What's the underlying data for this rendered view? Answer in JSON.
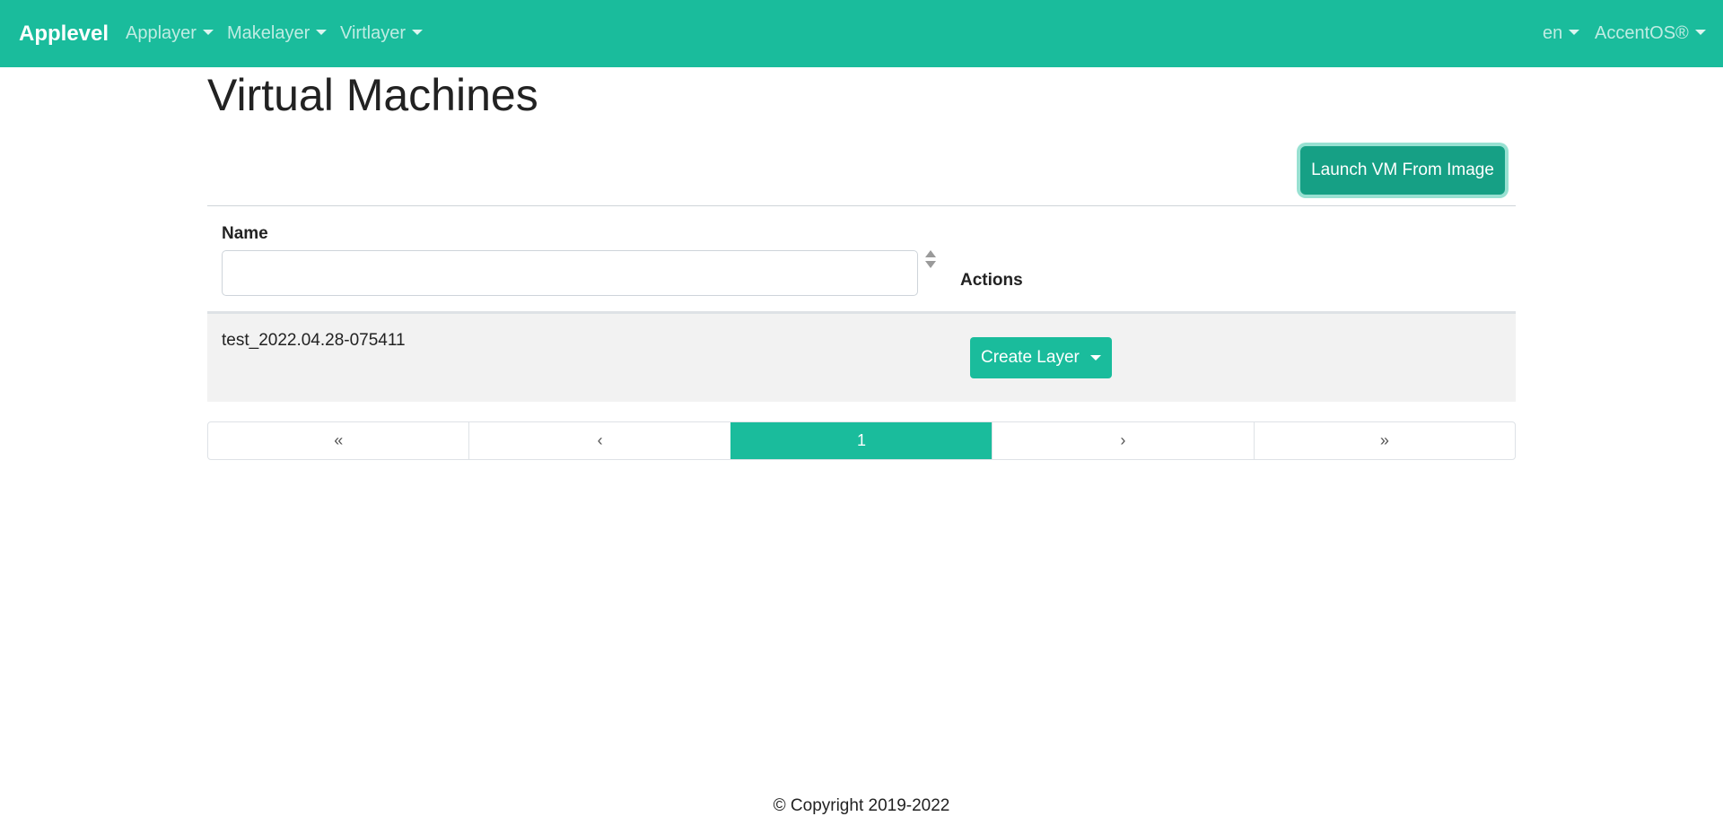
{
  "navbar": {
    "brand": "Applevel",
    "menus": [
      {
        "label": "Applayer"
      },
      {
        "label": "Makelayer"
      },
      {
        "label": "Virtlayer"
      }
    ],
    "language": "en",
    "account": "AccentOS®"
  },
  "main": {
    "title": "Virtual Machines",
    "launch_button": "Launch VM From Image",
    "table": {
      "headers": {
        "name": "Name",
        "actions": "Actions"
      },
      "name_filter_value": "",
      "rows": [
        {
          "name": "test_2022.04.28-075411",
          "action_label": "Create Layer"
        }
      ]
    },
    "pagination": {
      "first": "«",
      "prev": "‹",
      "current": "1",
      "next": "›",
      "last": "»"
    }
  },
  "footer": {
    "copyright": "© Copyright 2019-2022"
  },
  "colors": {
    "accent": "#1abc9c",
    "accent_dark": "#16a085"
  }
}
